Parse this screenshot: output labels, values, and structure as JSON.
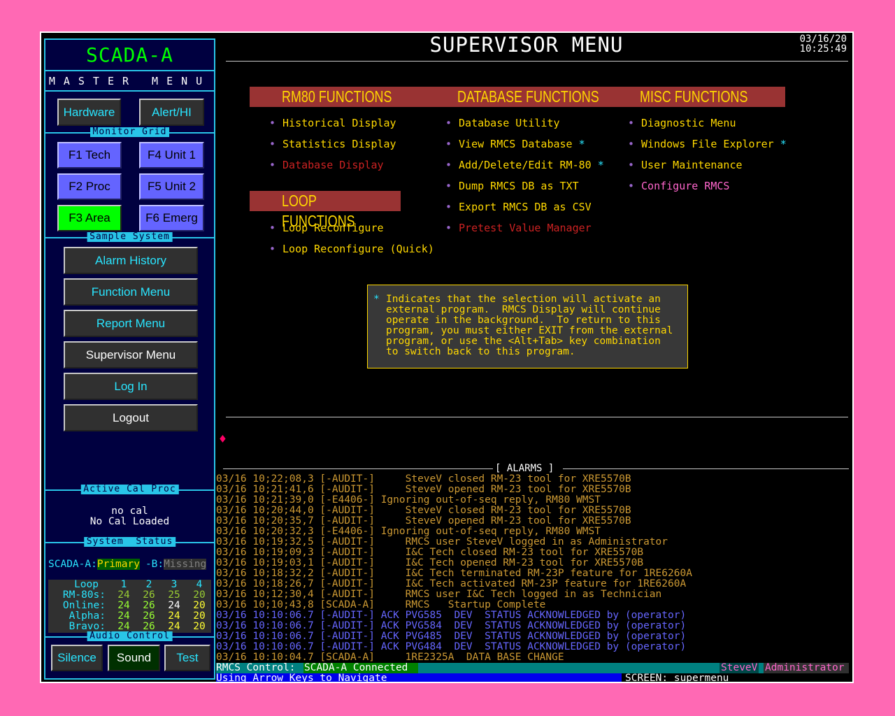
{
  "left": {
    "title": "SCADA-A",
    "master_menu": "MASTER MENU",
    "top_buttons": [
      "Hardware",
      "Alert/HI"
    ],
    "monitor_grid": {
      "label": "Monitor Grid",
      "buttons": [
        "F1 Tech",
        "F4 Unit 1",
        "F2 Proc",
        "F5 Unit 2",
        "F3 Area",
        "F6 Emerg"
      ]
    },
    "sample_system": {
      "label": "Sample System",
      "buttons": [
        "Alarm History",
        "Function Menu",
        "Report Menu",
        "Supervisor Menu",
        "Log In",
        "Logout"
      ]
    },
    "active_cal": {
      "label": "Active Cal Proc",
      "line1": "no cal",
      "line2": "No Cal Loaded"
    },
    "system_status": {
      "label": "System  Status",
      "a_prefix": "SCADA-A:",
      "a_value": "Primary",
      "b_prefix": "-B:",
      "b_value": "Missing",
      "headers": [
        "Loop",
        "1",
        "2",
        "3",
        "4"
      ],
      "rows": [
        {
          "label": "RM-80s:",
          "values": [
            "24",
            "26",
            "25",
            "20"
          ]
        },
        {
          "label": "Online:",
          "values": [
            "24",
            "26",
            "24",
            "20"
          ]
        },
        {
          "label": "Alpha:",
          "values": [
            "24",
            "26",
            "24",
            "20"
          ]
        },
        {
          "label": "Bravo:",
          "values": [
            "24",
            "26",
            "24",
            "20"
          ]
        }
      ]
    },
    "audio": {
      "label": "Audio Control",
      "buttons": [
        "Silence",
        "Sound",
        "Test"
      ]
    }
  },
  "main": {
    "title": "SUPERVISOR MENU",
    "date": "03/16/20",
    "time": "10:25:49",
    "rm80": {
      "title": "RM80 FUNCTIONS",
      "items": [
        "Historical Display",
        "Statistics Display",
        "Database Display"
      ]
    },
    "loop": {
      "title": "LOOP FUNCTIONS",
      "items": [
        "Loop Reconfigure",
        "Loop Reconfigure (Quick)"
      ]
    },
    "database": {
      "title": "DATABASE FUNCTIONS",
      "items": [
        "Database Utility",
        "View RMCS Database",
        "Add/Delete/Edit RM-80",
        "Dump RMCS DB as TXT",
        "Export RMCS DB as CSV",
        "Pretest Value Manager"
      ]
    },
    "misc": {
      "title": "MISC FUNCTIONS",
      "items": [
        "Diagnostic Menu",
        "Windows File Explorer",
        "User Maintenance",
        "Configure RMCS"
      ]
    },
    "star": "*",
    "note_lines": [
      "Indicates that the selection will activate an",
      "external program.  RMCS Display will continue",
      "operate in the background.  To return to this",
      "program, you must either EXIT from the external",
      "program, or use the <Alt+Tab> key combination",
      "to switch back to this program."
    ],
    "alarms_label": "[ ALARMS ]",
    "alarms": [
      "03/16 10;22;08,3 [-AUDIT-]     SteveV closed RM-23 tool for XRE5570B",
      "03/16 10;21;41,6 [-AUDIT-]     SteveV opened RM-23 tool for XRE5570B",
      "03/16 10;21;39,0 [-E4406-] Ignoring out-of-seq reply, RM80 WMST",
      "03/16 10;20;44,0 [-AUDIT-]     SteveV closed RM-23 tool for XRE5570B",
      "03/16 10;20;35,7 [-AUDIT-]     SteveV opened RM-23 tool for XRE5570B",
      "03/16 10;20;32,3 [-E4406-] Ignoring out-of-seq reply, RM80 WMST",
      "03/16 10;19;32,5 [-AUDIT-]     RMCS user SteveV logged in as Administrator",
      "03/16 10;19;09,3 [-AUDIT-]     I&C Tech closed RM-23 tool for XRE5570B",
      "03/16 10;19;03,1 [-AUDIT-]     I&C Tech opened RM-23 tool for XRE5570B",
      "03/16 10;18;32,2 [-AUDIT-]     I&C Tech terminated RM-23P feature for 1RE6260A",
      "03/16 10;18;26,7 [-AUDIT-]     I&C Tech activated RM-23P feature for 1RE6260A",
      "03/16 10;12;30,4 [-AUDIT-]     RMCS user I&C Tech logged in as Technician",
      "03/16 10;10;43,8 [SCADA-A]     RMCS   Startup Complete",
      "03/16 10:10:06.7 [-AUDIT-] ACK PVG585  DEV  STATUS ACKNOWLEDGED by (operator)",
      "03/16 10:10:06.7 [-AUDIT-] ACK PVG584  DEV  STATUS ACKNOWLEDGED by (operator)",
      "03/16 10:10:06.7 [-AUDIT-] ACK PVG485  DEV  STATUS ACKNOWLEDGED by (operator)",
      "03/16 10:10:06.7 [-AUDIT-] ACK PVG484  DEV  STATUS ACKNOWLEDGED by (operator)",
      "03/16 10:10:04.7 [SCADA-A]     1RE2325A  DATA BASE CHANGE"
    ],
    "status": {
      "label": "RMCS Control:",
      "value": "SCADA-A Connected",
      "user": "SteveV",
      "role": "Administrator"
    },
    "nav_hint": "Using Arrow Keys to Navigate",
    "screen": "SCREEN: supermenu"
  },
  "colors": {
    "background": "#ff69b4",
    "panel_border": "#29c5e8",
    "menu_text": "#ffd800",
    "band": "#993333",
    "alarm_audit": "#cc9933",
    "alarm_ack": "#6666ff"
  }
}
